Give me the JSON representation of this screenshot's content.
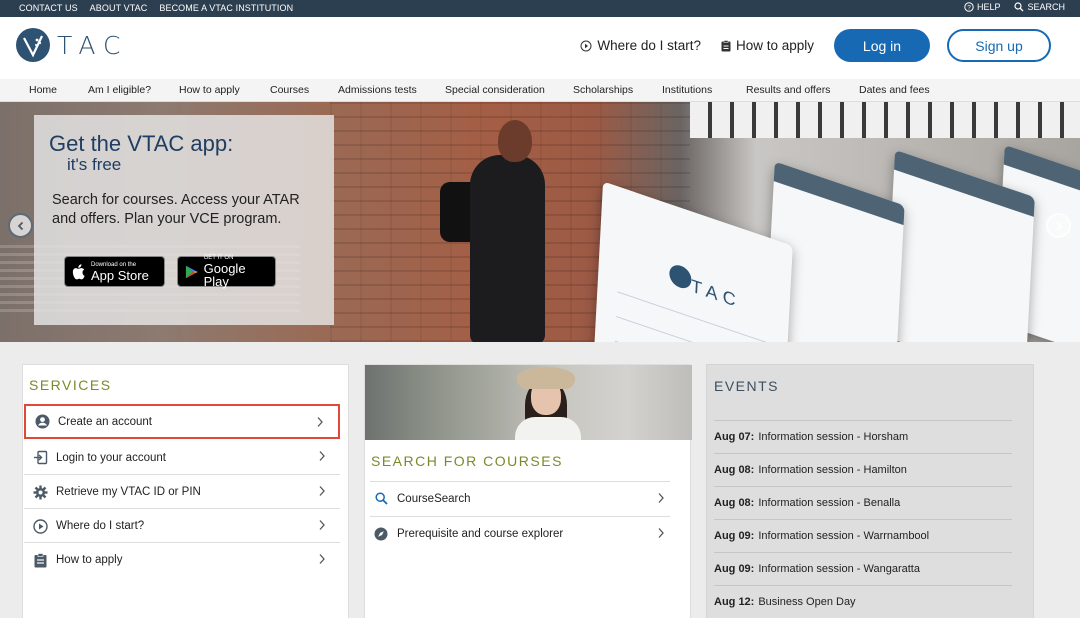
{
  "topbar": {
    "links": [
      "CONTACT US",
      "ABOUT VTAC",
      "BECOME A VTAC INSTITUTION"
    ],
    "help": "HELP",
    "search": "SEARCH"
  },
  "header": {
    "logo_text": "TAC",
    "where_start": "Where do I start?",
    "how_apply": "How to apply",
    "login": "Log in",
    "signup": "Sign up"
  },
  "nav": {
    "items": [
      "Home",
      "Am I eligible?",
      "How to apply",
      "Courses",
      "Admissions tests",
      "Special consideration",
      "Scholarships",
      "Institutions",
      "Results and offers",
      "Dates and fees"
    ]
  },
  "hero": {
    "title": "Get the VTAC app:",
    "subtitle": "it's free",
    "description": "Search for courses. Access your ATAR and offers. Plan your VCE program.",
    "app_store_small": "Download on the",
    "app_store_big": "App Store",
    "google_small": "GET IT ON",
    "google_big": "Google Play",
    "phone_logo": "TAC"
  },
  "services": {
    "title": "SERVICES",
    "items": [
      "Create an account",
      "Login to your account",
      "Retrieve my VTAC ID or PIN",
      "Where do I start?",
      "How to apply"
    ]
  },
  "courses": {
    "title": "SEARCH FOR COURSES",
    "items": [
      "CourseSearch",
      "Prerequisite and course explorer"
    ]
  },
  "events": {
    "title": "EVENTS",
    "items": [
      {
        "date": "Aug 07:",
        "text": "Information session - Horsham"
      },
      {
        "date": "Aug 08:",
        "text": "Information session - Hamilton"
      },
      {
        "date": "Aug 08:",
        "text": "Information session - Benalla"
      },
      {
        "date": "Aug 09:",
        "text": "Information session - Warrnambool"
      },
      {
        "date": "Aug 09:",
        "text": "Information session - Wangaratta"
      },
      {
        "date": "Aug 12:",
        "text": "Business Open Day"
      }
    ]
  },
  "colors": {
    "topbar": "#2b3f50",
    "brand_blue": "#1769b3",
    "section_title": "#7a8a2a",
    "highlight": "#e0493a"
  },
  "icons": [
    "question-circle-icon",
    "search-icon",
    "play-circle-icon",
    "clipboard-icon",
    "user-circle-icon",
    "login-icon",
    "gear-icon",
    "compass-icon",
    "chevron-right-icon",
    "apple-icon",
    "google-play-icon"
  ]
}
